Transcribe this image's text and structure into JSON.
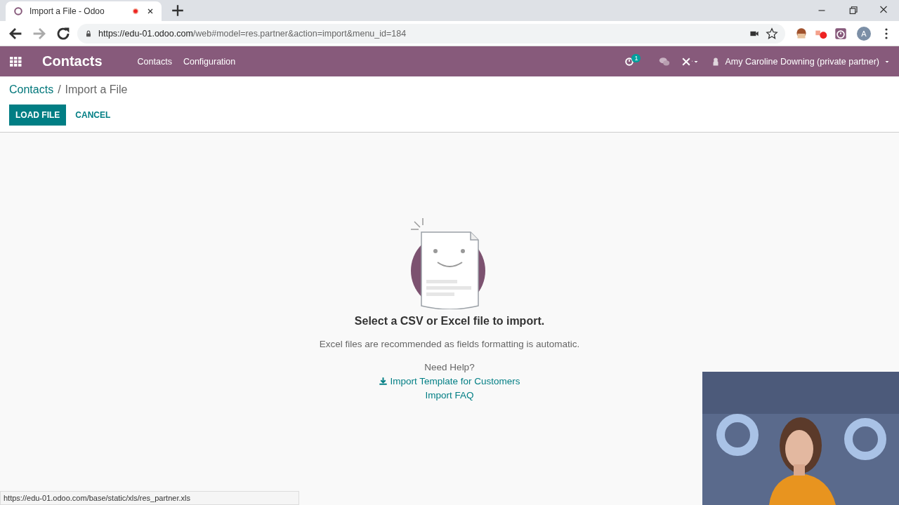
{
  "browser": {
    "tab_title": "Import a File - Odoo",
    "url_host": "https://edu-01.odoo.com",
    "url_path": "/web#model=res.partner&action=import&menu_id=184",
    "profile_initial": "A"
  },
  "navbar": {
    "app_name": "Contacts",
    "menu": [
      "Contacts",
      "Configuration"
    ],
    "activity_count": "1",
    "user": "Amy Caroline Downing (private partner)"
  },
  "breadcrumb": [
    {
      "label": "Contacts",
      "kind": "link"
    },
    {
      "label": "Import a File",
      "kind": "current",
      "separator": "/"
    }
  ],
  "buttons": [
    {
      "label": "LOAD FILE",
      "kind": "primary"
    },
    {
      "label": "CANCEL",
      "kind": "link"
    }
  ],
  "empty_state": {
    "title": "Select a CSV or Excel file to import.",
    "subtitle": "Excel files are recommended as fields formatting is automatic.",
    "help_label": "Need Help?",
    "links": [
      {
        "label": "Import Template for Customers",
        "kind": "download"
      },
      {
        "label": "Import FAQ",
        "kind": "plain"
      }
    ]
  },
  "status_url": "https://edu-01.odoo.com/base/static/xls/res_partner.xls"
}
